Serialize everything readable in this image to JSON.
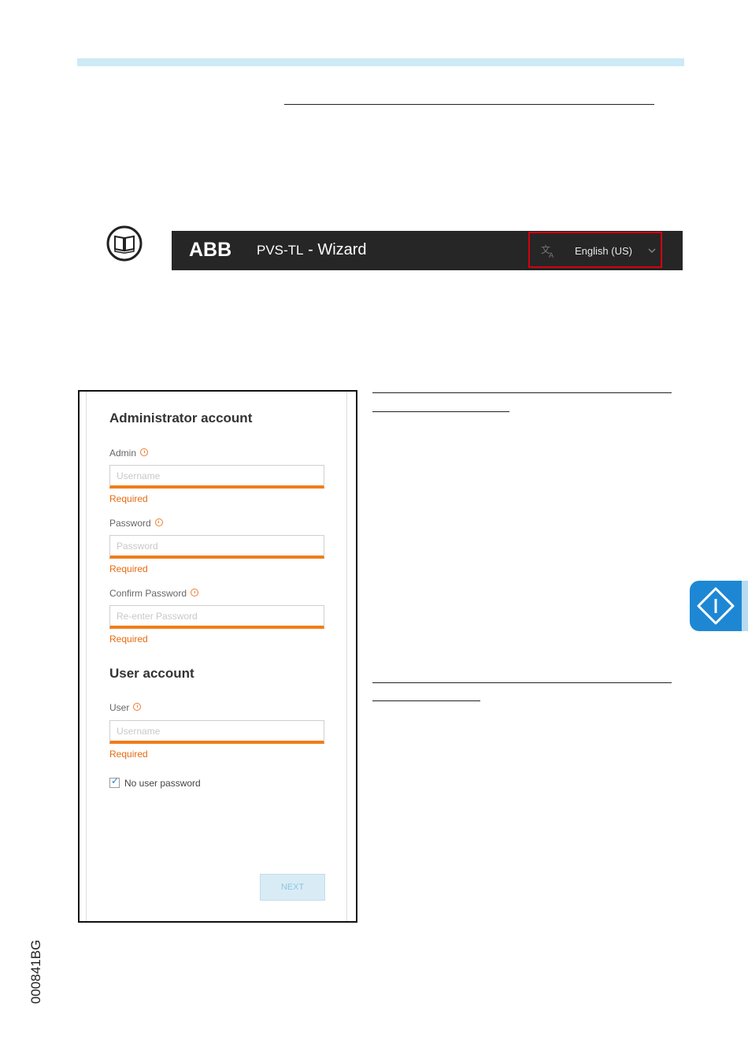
{
  "header_bar": {
    "logo_text": "ABB",
    "product": "PVS-TL",
    "separator": " - ",
    "title": "Wizard",
    "language_icon": "translate-icon",
    "language_label": "English (US)",
    "chevron_icon": "chevron-down-icon"
  },
  "form": {
    "admin_section_title": "Administrator account",
    "admin_label": "Admin",
    "admin_placeholder": "Username",
    "password_label": "Password",
    "password_placeholder": "Password",
    "confirm_label": "Confirm Password",
    "confirm_placeholder": "Re-enter Password",
    "required_text": "Required",
    "user_section_title": "User account",
    "user_label": "User",
    "user_placeholder": "Username",
    "no_password_checkbox_label": "No user password",
    "no_password_checked": true,
    "next_label": "NEXT"
  },
  "document": {
    "code": "000841BG",
    "manual_icon": "book-icon",
    "side_tab_icon": "diamond-info-icon"
  },
  "colors": {
    "accent_orange": "#ef7d1a",
    "highlight_red": "#d4000f",
    "side_tab_blue": "#1e87d4",
    "top_rule_blue": "#cdeaf7"
  }
}
